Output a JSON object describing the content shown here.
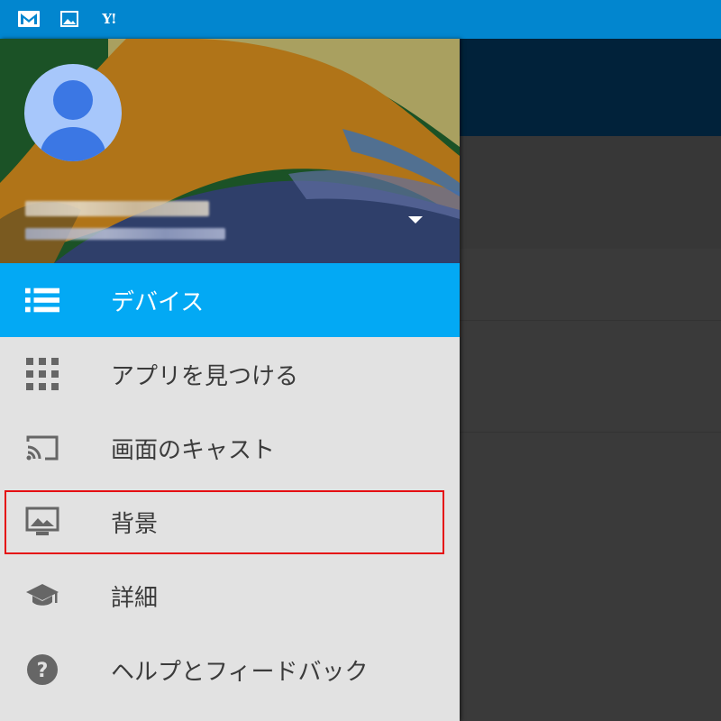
{
  "status_bar": {
    "icons": [
      "gmail-icon",
      "photo-icon",
      "yahoo-icon"
    ],
    "yahoo_text": "Y!",
    "color": "#0286cf"
  },
  "drawer": {
    "header": {
      "avatar_icon": "account-icon",
      "dropdown_icon": "dropdown-arrow-icon"
    },
    "items": [
      {
        "label": "デバイス",
        "icon": "list-icon",
        "active": true
      },
      {
        "label": "アプリを見つける",
        "icon": "apps-grid-icon"
      },
      {
        "label": "画面のキャスト",
        "icon": "cast-icon"
      },
      {
        "label": "背景",
        "icon": "wallpaper-icon",
        "highlighted": true
      },
      {
        "label": "詳細",
        "icon": "school-icon"
      },
      {
        "label": "ヘルプとフィードバック",
        "icon": "help-icon"
      }
    ],
    "active_color": "#03a9f4",
    "highlight_color": "#e50f13"
  }
}
